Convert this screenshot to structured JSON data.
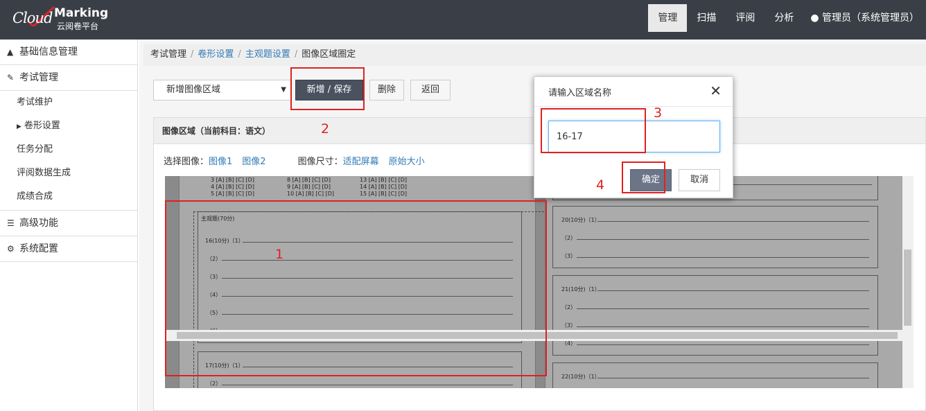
{
  "logo": {
    "cloud": "Cloud",
    "marking": "Marking",
    "subtitle": "云阅卷平台"
  },
  "topnav": {
    "items": [
      "管理",
      "扫描",
      "评阅",
      "分析"
    ],
    "user": "管理员（系统管理员）"
  },
  "sidebar": {
    "base_info": "基础信息管理",
    "exam_mgmt": "考试管理",
    "sub_items": [
      "考试维护",
      "卷形设置",
      "任务分配",
      "评阅数据生成",
      "成绩合成"
    ],
    "advanced": "高级功能",
    "sys_config": "系统配置"
  },
  "breadcrumb": {
    "items": [
      "考试管理",
      "卷形设置",
      "主观题设置",
      "图像区域圈定"
    ],
    "separator": "/"
  },
  "toolbar": {
    "select_value": "新增图像区域",
    "add_save": "新增 / 保存",
    "delete": "删除",
    "back": "返回"
  },
  "panel": {
    "title": "图像区域（当前科目：语文）",
    "select_image_label": "选择图像：",
    "images": [
      "图像1",
      "图像2"
    ],
    "size_label": "图像尺寸：",
    "size_options": [
      "适配屏幕",
      "原始大小"
    ]
  },
  "sheet": {
    "mc_rows": [
      "3 [A] [B] [C] [D]",
      "4 [A] [B] [C] [D]",
      "5 [A] [B] [C] [D]",
      "8 [A] [B] [C] [D]",
      "9 [A] [B] [C] [D]",
      "10 [A] [B] [C] [D]",
      "13 [A] [B] [C] [D]",
      "14 [A] [B] [C] [D]",
      "15 [A] [B] [C] [D]"
    ],
    "section_title": "主观题(70分)",
    "q16": "16(10分)（1）",
    "q16_parts": [
      "（2）",
      "（3）",
      "（4）",
      "（5）",
      "（6）"
    ],
    "q17": "17(10分)（1）",
    "q17_part2": "（2）",
    "q20": "20(10分)（1）",
    "q20_parts": [
      "（2）",
      "（3）"
    ],
    "q21": "21(10分)（1）",
    "q21_parts": [
      "（2）",
      "（3）",
      "（4）"
    ],
    "q22": "22(10分)（1）"
  },
  "dialog": {
    "title": "请输入区域名称",
    "close": "✕",
    "input_value": "16-17",
    "ok": "确定",
    "cancel": "取消"
  },
  "annotations": {
    "n1": "1",
    "n2": "2",
    "n3": "3",
    "n4": "4",
    "color": "#e02020"
  }
}
